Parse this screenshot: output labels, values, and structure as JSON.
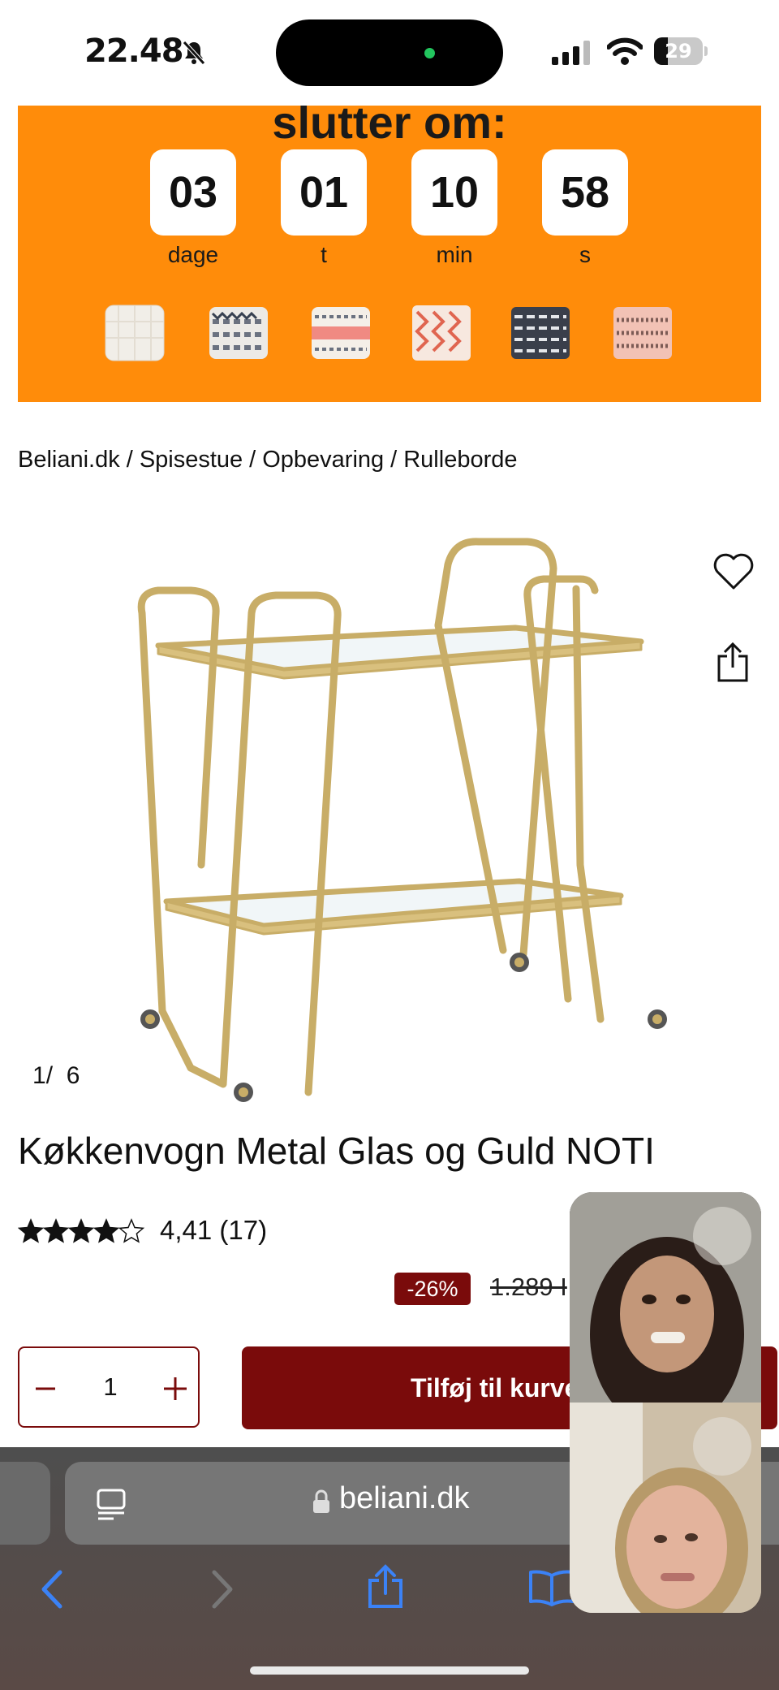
{
  "status_bar": {
    "time": "22.48",
    "battery": "29",
    "battery_level": 0.29
  },
  "banner": {
    "title": "slutter om:",
    "countdown": [
      {
        "value": "03",
        "unit": "dage"
      },
      {
        "value": "01",
        "unit": "t"
      },
      {
        "value": "10",
        "unit": "min"
      },
      {
        "value": "58",
        "unit": "s"
      }
    ]
  },
  "breadcrumb": [
    "Beliani.dk",
    "Spisestue",
    "Opbevaring",
    "Rulleborde"
  ],
  "gallery": {
    "current": "1",
    "separator": "/",
    "total": "6"
  },
  "product": {
    "title": "Køkkenvogn Metal Glas og Guld NOTI",
    "rating_text": "4,41 (17)",
    "rating_value": 4.41,
    "discount": "-26%",
    "old_price": "1.289 I",
    "quantity": "1",
    "add_to_cart": "Tilføj til kurve"
  },
  "browser": {
    "url": "beliani.dk"
  },
  "colors": {
    "banner_orange": "#ff8c0a",
    "brand_dark_red": "#7a0b0b",
    "safari_blue": "#3b82f6"
  }
}
